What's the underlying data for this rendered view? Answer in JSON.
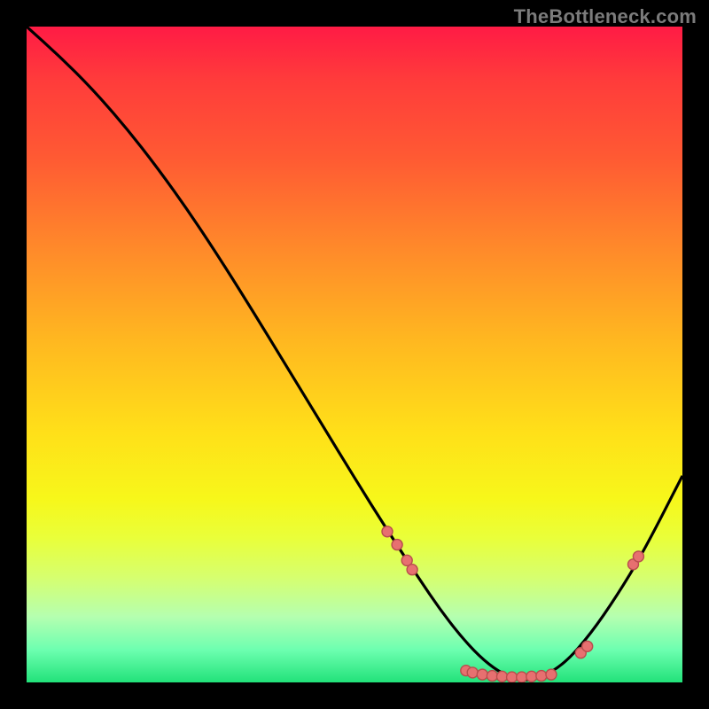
{
  "watermark": "TheBottleneck.com",
  "chart_data": {
    "type": "line",
    "title": "",
    "xlabel": "",
    "ylabel": "",
    "xlim": [
      0,
      100
    ],
    "ylim": [
      0,
      100
    ],
    "grid": false,
    "legend": false,
    "curve": {
      "x": [
        0,
        5,
        10,
        15,
        20,
        25,
        30,
        35,
        40,
        45,
        50,
        55,
        60,
        63,
        66,
        69,
        72,
        75,
        78,
        82,
        86,
        90,
        94,
        100
      ],
      "y": [
        100,
        95.5,
        90.5,
        84.8,
        78.4,
        71.4,
        63.8,
        55.8,
        47.6,
        39.4,
        31.2,
        23.2,
        15.6,
        11.2,
        7.3,
        4.0,
        1.6,
        0.3,
        0.5,
        2.8,
        7.4,
        13.2,
        19.8,
        31.5
      ]
    },
    "background_gradient": {
      "top": "#ff1b45",
      "mid": "#ffe019",
      "bottom": "#22e27a"
    },
    "markers": [
      {
        "x": 55.0,
        "y": 23.0
      },
      {
        "x": 56.5,
        "y": 21.0
      },
      {
        "x": 58.0,
        "y": 18.6
      },
      {
        "x": 58.8,
        "y": 17.2
      },
      {
        "x": 67.0,
        "y": 1.8
      },
      {
        "x": 68.0,
        "y": 1.5
      },
      {
        "x": 69.5,
        "y": 1.2
      },
      {
        "x": 71.0,
        "y": 1.0
      },
      {
        "x": 72.5,
        "y": 0.9
      },
      {
        "x": 74.0,
        "y": 0.8
      },
      {
        "x": 75.5,
        "y": 0.8
      },
      {
        "x": 77.0,
        "y": 0.9
      },
      {
        "x": 78.5,
        "y": 1.0
      },
      {
        "x": 80.0,
        "y": 1.2
      },
      {
        "x": 84.5,
        "y": 4.5
      },
      {
        "x": 85.5,
        "y": 5.5
      },
      {
        "x": 92.5,
        "y": 18.0
      },
      {
        "x": 93.3,
        "y": 19.2
      }
    ],
    "marker_style": {
      "fill": "#e77070",
      "stroke": "#b84d4d",
      "radius_px": 6
    }
  }
}
